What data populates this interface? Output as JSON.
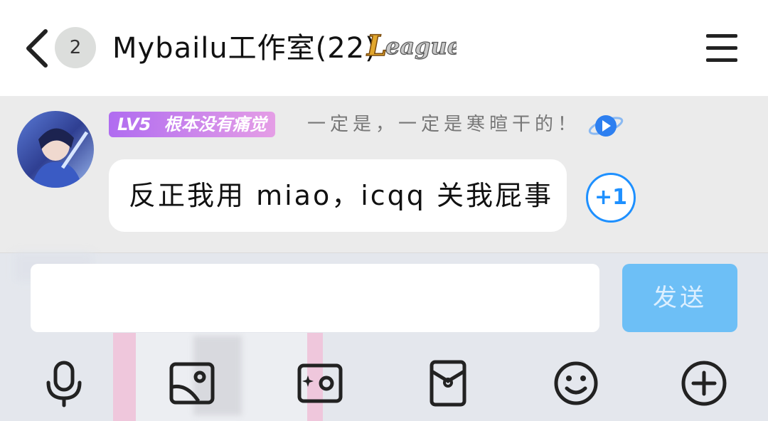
{
  "header": {
    "unread_count": "2",
    "title": "Mybailu工作室(22)",
    "logo_text": "League"
  },
  "message": {
    "level": "LV5",
    "member_title": "根本没有痛觉",
    "sender_name": "一定是，一定是寒暄干的！",
    "text": "反正我用 miao，icqq 关我屁事",
    "plus_one_label": "+1"
  },
  "input": {
    "value": "",
    "send_label": "发送"
  },
  "toolbar": {
    "icons": [
      "microphone-icon",
      "image-icon",
      "camera-icon",
      "red-packet-icon",
      "emoji-icon",
      "plus-icon"
    ]
  },
  "colors": {
    "accent": "#1e90ff",
    "send_bg": "#6dbff6",
    "level_badge": "#b06cf0"
  }
}
